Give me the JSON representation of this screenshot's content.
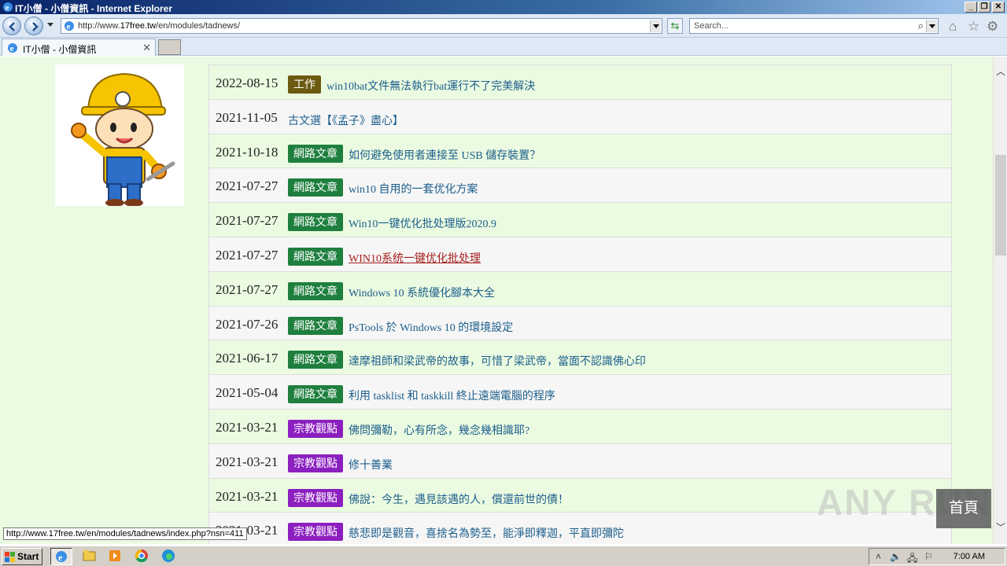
{
  "window": {
    "title": "IT小僧 - 小僧資訊 - Internet Explorer",
    "minimize_label": "_",
    "restore_label": "❐",
    "close_label": "✕"
  },
  "addressbar": {
    "url_prefix": "http://www.",
    "url_host": "17free.tw",
    "url_path": "/en/modules/tadnews/",
    "search_placeholder": "Search..."
  },
  "tabs": [
    {
      "label": "IT小僧 - 小僧資訊",
      "close": "✕"
    }
  ],
  "news": [
    {
      "date": "2022-08-15",
      "badge": "工作",
      "badge_color": "#6b5a10",
      "title": "win10bat文件無法執行bat運行不了完美解決"
    },
    {
      "date": "2021-11-05",
      "badge": "",
      "badge_color": "",
      "title": "古文選【《孟子》盡心】"
    },
    {
      "date": "2021-10-18",
      "badge": "網路文章",
      "badge_color": "#1e7f3e",
      "title": "如何避免使用者連接至 USB 儲存裝置？"
    },
    {
      "date": "2021-07-27",
      "badge": "網路文章",
      "badge_color": "#1e7f3e",
      "title": "win10 自用的一套优化方案"
    },
    {
      "date": "2021-07-27",
      "badge": "網路文章",
      "badge_color": "#1e7f3e",
      "title": "Win10一键优化批处理版2020.9"
    },
    {
      "date": "2021-07-27",
      "badge": "網路文章",
      "badge_color": "#1e7f3e",
      "title": "WIN10系统一键优化批处理",
      "hover": true
    },
    {
      "date": "2021-07-27",
      "badge": "網路文章",
      "badge_color": "#1e7f3e",
      "title": "Windows 10 系統優化腳本大全"
    },
    {
      "date": "2021-07-26",
      "badge": "網路文章",
      "badge_color": "#1e7f3e",
      "title": "PsTools 於 Windows 10 的環境設定"
    },
    {
      "date": "2021-06-17",
      "badge": "網路文章",
      "badge_color": "#1e7f3e",
      "title": "達摩祖師和梁武帝的故事，可惜了梁武帝，當面不認識佛心印"
    },
    {
      "date": "2021-05-04",
      "badge": "網路文章",
      "badge_color": "#1e7f3e",
      "title": "利用 tasklist 和 taskkill 終止遠端電腦的程序"
    },
    {
      "date": "2021-03-21",
      "badge": "宗教觀點",
      "badge_color": "#8b1fbf",
      "title": "佛問彌勒，心有所念，幾念幾相識耶?"
    },
    {
      "date": "2021-03-21",
      "badge": "宗教觀點",
      "badge_color": "#8b1fbf",
      "title": "修十善業"
    },
    {
      "date": "2021-03-21",
      "badge": "宗教觀點",
      "badge_color": "#8b1fbf",
      "title": "佛說：今生，遇見該遇的人，償還前世的債！"
    },
    {
      "date": "2021-03-21",
      "badge": "宗教觀點",
      "badge_color": "#8b1fbf",
      "title": "慈悲即是觀音，喜捨名為勢至，能淨即釋迦，平直即彌陀"
    }
  ],
  "overlay": {
    "watermark": "ANY RUN",
    "home_button": "首頁"
  },
  "status": {
    "hover_url": "http://www.17free.tw/en/modules/tadnews/index.php?nsn=411"
  },
  "taskbar": {
    "start_label": "Start",
    "clock": "7:00 AM"
  }
}
